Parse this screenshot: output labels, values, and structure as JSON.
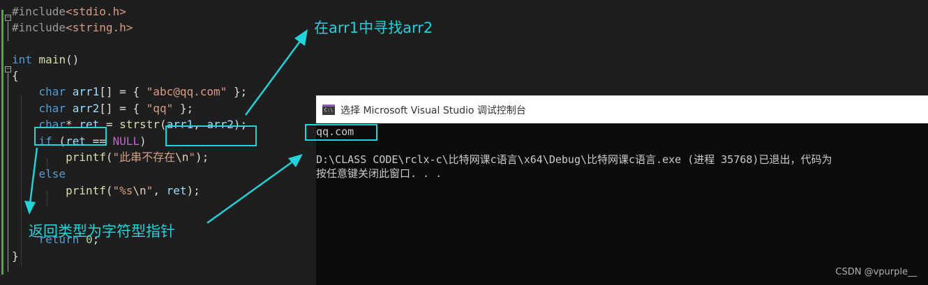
{
  "editor": {
    "lines": [
      {
        "tokens": [
          {
            "t": "#include",
            "c": "inc"
          },
          {
            "t": "<stdio.h>",
            "c": "hdr"
          }
        ]
      },
      {
        "tokens": [
          {
            "t": "#include",
            "c": "inc"
          },
          {
            "t": "<string.h>",
            "c": "hdr"
          }
        ]
      },
      {
        "tokens": []
      },
      {
        "tokens": [
          {
            "t": "int",
            "c": "kw"
          },
          {
            "t": " "
          },
          {
            "t": "main",
            "c": "fn"
          },
          {
            "t": "()"
          }
        ]
      },
      {
        "tokens": [
          {
            "t": "{"
          }
        ]
      },
      {
        "tokens": [
          {
            "t": "    "
          },
          {
            "t": "char",
            "c": "kw"
          },
          {
            "t": " "
          },
          {
            "t": "arr1",
            "c": "id"
          },
          {
            "t": "[] = { "
          },
          {
            "t": "\"abc@qq.com\"",
            "c": "str"
          },
          {
            "t": " };"
          }
        ]
      },
      {
        "tokens": [
          {
            "t": "    "
          },
          {
            "t": "char",
            "c": "kw"
          },
          {
            "t": " "
          },
          {
            "t": "arr2",
            "c": "id"
          },
          {
            "t": "[] = { "
          },
          {
            "t": "\"qq\"",
            "c": "str"
          },
          {
            "t": " };"
          }
        ]
      },
      {
        "tokens": [
          {
            "t": "    "
          },
          {
            "t": "char",
            "c": "kw"
          },
          {
            "t": "* "
          },
          {
            "t": "ret",
            "c": "id"
          },
          {
            "t": " = "
          },
          {
            "t": "strstr",
            "c": "fn"
          },
          {
            "t": "("
          },
          {
            "t": "arr1",
            "c": "id"
          },
          {
            "t": ", "
          },
          {
            "t": "arr2",
            "c": "id"
          },
          {
            "t": ");"
          }
        ]
      },
      {
        "tokens": [
          {
            "t": "    "
          },
          {
            "t": "if",
            "c": "kw"
          },
          {
            "t": " ("
          },
          {
            "t": "ret",
            "c": "id"
          },
          {
            "t": " == "
          },
          {
            "t": "NULL",
            "c": "macro"
          },
          {
            "t": ")"
          }
        ]
      },
      {
        "tokens": [
          {
            "t": "        "
          },
          {
            "t": "printf",
            "c": "fn"
          },
          {
            "t": "("
          },
          {
            "t": "\"此串不存在",
            "c": "str"
          },
          {
            "t": "\\n",
            "c": "esc"
          },
          {
            "t": "\"",
            "c": "str"
          },
          {
            "t": ");"
          }
        ]
      },
      {
        "tokens": [
          {
            "t": "    "
          },
          {
            "t": "else",
            "c": "kw"
          }
        ]
      },
      {
        "tokens": [
          {
            "t": "        "
          },
          {
            "t": "printf",
            "c": "fn"
          },
          {
            "t": "("
          },
          {
            "t": "\"%s",
            "c": "str"
          },
          {
            "t": "\\n",
            "c": "esc"
          },
          {
            "t": "\"",
            "c": "str"
          },
          {
            "t": ", "
          },
          {
            "t": "ret",
            "c": "id"
          },
          {
            "t": ");"
          }
        ]
      },
      {
        "tokens": []
      },
      {
        "tokens": []
      },
      {
        "tokens": [
          {
            "t": "    "
          },
          {
            "t": "return",
            "c": "kw"
          },
          {
            "t": " "
          },
          {
            "t": "0",
            "c": "num"
          },
          {
            "t": ";"
          }
        ]
      },
      {
        "tokens": [
          {
            "t": "}"
          }
        ]
      }
    ]
  },
  "annotations": {
    "search_note": "在arr1中寻找arr2",
    "return_type_note": "返回类型为字符型指针",
    "accent_color": "#23d3d9"
  },
  "console": {
    "title": "选择 Microsoft Visual Studio 调试控制台",
    "icon_label": "C:\\",
    "output_line1": "qq.com",
    "output_line2": "D:\\CLASS CODE\\rclx-c\\比特网课c语言\\x64\\Debug\\比特网课c语言.exe (进程 35768)已退出，代码为",
    "output_line3": "按任意键关闭此窗口. . ."
  },
  "watermark": "CSDN @vpurple__"
}
